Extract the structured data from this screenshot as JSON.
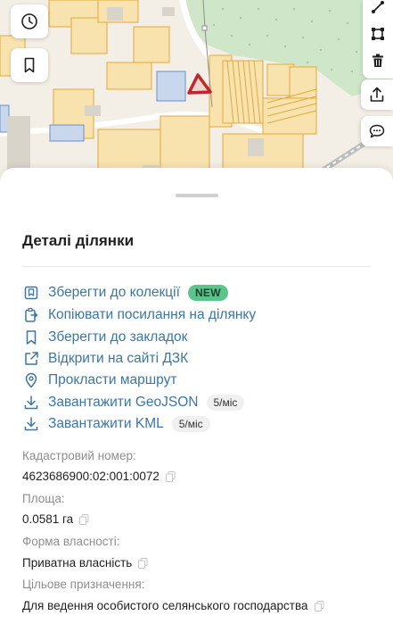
{
  "map": {
    "history_button": "clock-icon",
    "bookmarks_button": "bookmark-icon",
    "tools": [
      "measure-line-icon",
      "measure-area-icon",
      "trash-icon"
    ],
    "share_button": "share-icon",
    "comment_button": "comment-icon"
  },
  "sheet": {
    "title": "Деталі ділянки",
    "actions": [
      {
        "label": "Зберегти до колекції",
        "icon": "collection-icon",
        "badge": "NEW"
      },
      {
        "label": "Копіювати посилання на ділянку",
        "icon": "copy-link-icon"
      },
      {
        "label": "Зберегти до закладок",
        "icon": "bookmark-icon"
      },
      {
        "label": "Відкрити на сайті ДЗК",
        "icon": "external-link-icon"
      },
      {
        "label": "Прокласти маршрут",
        "icon": "location-pin-icon"
      },
      {
        "label": "Завантажити GeoJSON",
        "icon": "download-icon",
        "badge": "5/міс"
      },
      {
        "label": "Завантажити KML",
        "icon": "download-icon",
        "badge": "5/міс"
      }
    ],
    "fields": [
      {
        "label": "Кадастровий номер:",
        "value": "4623686900:02:001:0072"
      },
      {
        "label": "Площа:",
        "value": "0.0581 га"
      },
      {
        "label": "Форма власності:",
        "value": "Приватна власність"
      },
      {
        "label": "Цільове призначення:",
        "value": "Для ведення особистого селянського господарства"
      }
    ]
  },
  "colors": {
    "link": "#3b76a6",
    "parcel_stroke": "#e0a93c",
    "parcel_fill": "#f8e3ae",
    "selected_parcel": "#c0262a",
    "forest": "#cfe6c8",
    "badge_new": "#5ac58a"
  }
}
